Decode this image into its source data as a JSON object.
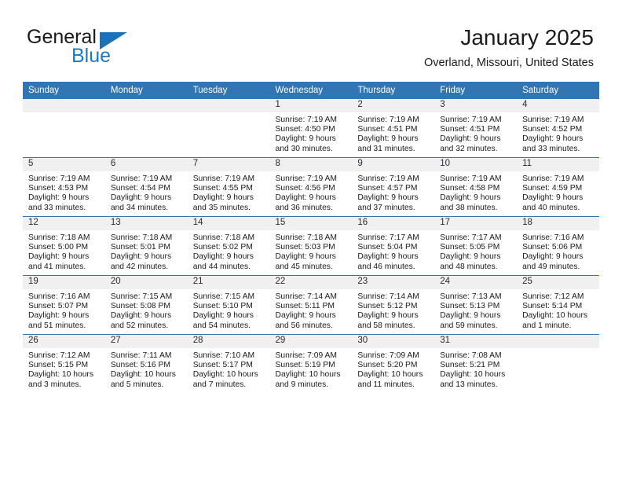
{
  "brand": {
    "name_part1": "General",
    "name_part2": "Blue",
    "flag_color": "#1d71b8",
    "blue_text_color": "#1a7ac4"
  },
  "header": {
    "title": "January 2025",
    "location": "Overland, Missouri, United States"
  },
  "theme": {
    "header_row_bg": "#3175b5",
    "daynum_band_bg": "#f0f0f0",
    "grid_line": "#3175b5",
    "text": "#1a1a1a"
  },
  "weekday_headers": [
    "Sunday",
    "Monday",
    "Tuesday",
    "Wednesday",
    "Thursday",
    "Friday",
    "Saturday"
  ],
  "weeks": [
    [
      {
        "empty": true
      },
      {
        "empty": true
      },
      {
        "empty": true
      },
      {
        "day": "1",
        "sunrise": "Sunrise: 7:19 AM",
        "sunset": "Sunset: 4:50 PM",
        "daylight1": "Daylight: 9 hours",
        "daylight2": "and 30 minutes."
      },
      {
        "day": "2",
        "sunrise": "Sunrise: 7:19 AM",
        "sunset": "Sunset: 4:51 PM",
        "daylight1": "Daylight: 9 hours",
        "daylight2": "and 31 minutes."
      },
      {
        "day": "3",
        "sunrise": "Sunrise: 7:19 AM",
        "sunset": "Sunset: 4:51 PM",
        "daylight1": "Daylight: 9 hours",
        "daylight2": "and 32 minutes."
      },
      {
        "day": "4",
        "sunrise": "Sunrise: 7:19 AM",
        "sunset": "Sunset: 4:52 PM",
        "daylight1": "Daylight: 9 hours",
        "daylight2": "and 33 minutes."
      }
    ],
    [
      {
        "day": "5",
        "sunrise": "Sunrise: 7:19 AM",
        "sunset": "Sunset: 4:53 PM",
        "daylight1": "Daylight: 9 hours",
        "daylight2": "and 33 minutes."
      },
      {
        "day": "6",
        "sunrise": "Sunrise: 7:19 AM",
        "sunset": "Sunset: 4:54 PM",
        "daylight1": "Daylight: 9 hours",
        "daylight2": "and 34 minutes."
      },
      {
        "day": "7",
        "sunrise": "Sunrise: 7:19 AM",
        "sunset": "Sunset: 4:55 PM",
        "daylight1": "Daylight: 9 hours",
        "daylight2": "and 35 minutes."
      },
      {
        "day": "8",
        "sunrise": "Sunrise: 7:19 AM",
        "sunset": "Sunset: 4:56 PM",
        "daylight1": "Daylight: 9 hours",
        "daylight2": "and 36 minutes."
      },
      {
        "day": "9",
        "sunrise": "Sunrise: 7:19 AM",
        "sunset": "Sunset: 4:57 PM",
        "daylight1": "Daylight: 9 hours",
        "daylight2": "and 37 minutes."
      },
      {
        "day": "10",
        "sunrise": "Sunrise: 7:19 AM",
        "sunset": "Sunset: 4:58 PM",
        "daylight1": "Daylight: 9 hours",
        "daylight2": "and 38 minutes."
      },
      {
        "day": "11",
        "sunrise": "Sunrise: 7:19 AM",
        "sunset": "Sunset: 4:59 PM",
        "daylight1": "Daylight: 9 hours",
        "daylight2": "and 40 minutes."
      }
    ],
    [
      {
        "day": "12",
        "sunrise": "Sunrise: 7:18 AM",
        "sunset": "Sunset: 5:00 PM",
        "daylight1": "Daylight: 9 hours",
        "daylight2": "and 41 minutes."
      },
      {
        "day": "13",
        "sunrise": "Sunrise: 7:18 AM",
        "sunset": "Sunset: 5:01 PM",
        "daylight1": "Daylight: 9 hours",
        "daylight2": "and 42 minutes."
      },
      {
        "day": "14",
        "sunrise": "Sunrise: 7:18 AM",
        "sunset": "Sunset: 5:02 PM",
        "daylight1": "Daylight: 9 hours",
        "daylight2": "and 44 minutes."
      },
      {
        "day": "15",
        "sunrise": "Sunrise: 7:18 AM",
        "sunset": "Sunset: 5:03 PM",
        "daylight1": "Daylight: 9 hours",
        "daylight2": "and 45 minutes."
      },
      {
        "day": "16",
        "sunrise": "Sunrise: 7:17 AM",
        "sunset": "Sunset: 5:04 PM",
        "daylight1": "Daylight: 9 hours",
        "daylight2": "and 46 minutes."
      },
      {
        "day": "17",
        "sunrise": "Sunrise: 7:17 AM",
        "sunset": "Sunset: 5:05 PM",
        "daylight1": "Daylight: 9 hours",
        "daylight2": "and 48 minutes."
      },
      {
        "day": "18",
        "sunrise": "Sunrise: 7:16 AM",
        "sunset": "Sunset: 5:06 PM",
        "daylight1": "Daylight: 9 hours",
        "daylight2": "and 49 minutes."
      }
    ],
    [
      {
        "day": "19",
        "sunrise": "Sunrise: 7:16 AM",
        "sunset": "Sunset: 5:07 PM",
        "daylight1": "Daylight: 9 hours",
        "daylight2": "and 51 minutes."
      },
      {
        "day": "20",
        "sunrise": "Sunrise: 7:15 AM",
        "sunset": "Sunset: 5:08 PM",
        "daylight1": "Daylight: 9 hours",
        "daylight2": "and 52 minutes."
      },
      {
        "day": "21",
        "sunrise": "Sunrise: 7:15 AM",
        "sunset": "Sunset: 5:10 PM",
        "daylight1": "Daylight: 9 hours",
        "daylight2": "and 54 minutes."
      },
      {
        "day": "22",
        "sunrise": "Sunrise: 7:14 AM",
        "sunset": "Sunset: 5:11 PM",
        "daylight1": "Daylight: 9 hours",
        "daylight2": "and 56 minutes."
      },
      {
        "day": "23",
        "sunrise": "Sunrise: 7:14 AM",
        "sunset": "Sunset: 5:12 PM",
        "daylight1": "Daylight: 9 hours",
        "daylight2": "and 58 minutes."
      },
      {
        "day": "24",
        "sunrise": "Sunrise: 7:13 AM",
        "sunset": "Sunset: 5:13 PM",
        "daylight1": "Daylight: 9 hours",
        "daylight2": "and 59 minutes."
      },
      {
        "day": "25",
        "sunrise": "Sunrise: 7:12 AM",
        "sunset": "Sunset: 5:14 PM",
        "daylight1": "Daylight: 10 hours",
        "daylight2": "and 1 minute."
      }
    ],
    [
      {
        "day": "26",
        "sunrise": "Sunrise: 7:12 AM",
        "sunset": "Sunset: 5:15 PM",
        "daylight1": "Daylight: 10 hours",
        "daylight2": "and 3 minutes."
      },
      {
        "day": "27",
        "sunrise": "Sunrise: 7:11 AM",
        "sunset": "Sunset: 5:16 PM",
        "daylight1": "Daylight: 10 hours",
        "daylight2": "and 5 minutes."
      },
      {
        "day": "28",
        "sunrise": "Sunrise: 7:10 AM",
        "sunset": "Sunset: 5:17 PM",
        "daylight1": "Daylight: 10 hours",
        "daylight2": "and 7 minutes."
      },
      {
        "day": "29",
        "sunrise": "Sunrise: 7:09 AM",
        "sunset": "Sunset: 5:19 PM",
        "daylight1": "Daylight: 10 hours",
        "daylight2": "and 9 minutes."
      },
      {
        "day": "30",
        "sunrise": "Sunrise: 7:09 AM",
        "sunset": "Sunset: 5:20 PM",
        "daylight1": "Daylight: 10 hours",
        "daylight2": "and 11 minutes."
      },
      {
        "day": "31",
        "sunrise": "Sunrise: 7:08 AM",
        "sunset": "Sunset: 5:21 PM",
        "daylight1": "Daylight: 10 hours",
        "daylight2": "and 13 minutes."
      },
      {
        "empty": true
      }
    ]
  ]
}
